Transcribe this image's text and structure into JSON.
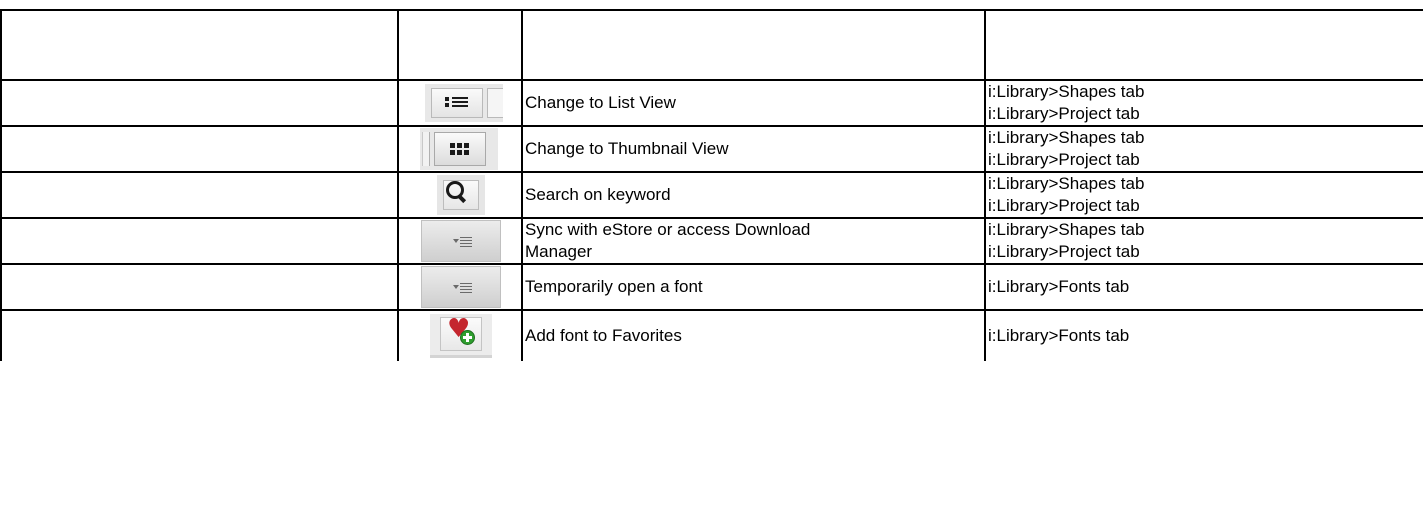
{
  "table": {
    "header": [
      "",
      "",
      "",
      ""
    ],
    "rows": [
      {
        "icon": "list-view-icon",
        "description": "Change to List View",
        "locations": [
          "i:Library>Shapes tab",
          "i:Library>Project tab"
        ]
      },
      {
        "icon": "thumbnail-view-icon",
        "description": "Change to Thumbnail View",
        "locations": [
          "i:Library>Shapes tab",
          "i:Library>Project tab"
        ]
      },
      {
        "icon": "search-icon",
        "description": "Search on keyword",
        "locations": [
          "i:Library>Shapes tab",
          "i:Library>Project tab"
        ]
      },
      {
        "icon": "sync-menu-icon",
        "description_lines": [
          "Sync with eStore or access Download",
          "Manager"
        ],
        "locations": [
          "i:Library>Shapes tab",
          "i:Library>Project tab"
        ]
      },
      {
        "icon": "font-menu-icon",
        "description": "Temporarily open a font",
        "locations": [
          "i:Library>Fonts tab"
        ]
      },
      {
        "icon": "add-favorite-heart-icon",
        "description": "Add font to Favorites",
        "locations": [
          "i:Library>Fonts tab"
        ]
      }
    ]
  }
}
